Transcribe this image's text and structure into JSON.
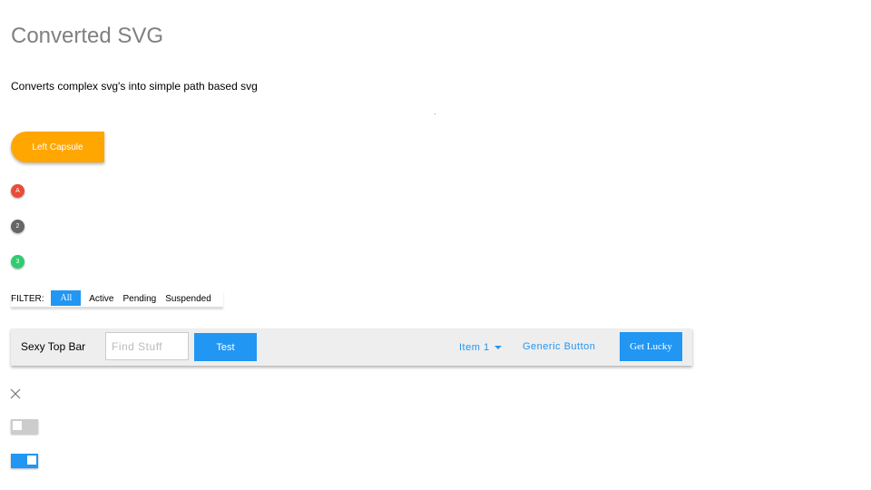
{
  "header": {
    "title": "Converted SVG",
    "subtitle": "Converts complex svg's into simple path based svg"
  },
  "capsule": {
    "label": "Left Capsule",
    "color": "#ffa600"
  },
  "badges": [
    {
      "label": "A",
      "color": "#ea4b3a"
    },
    {
      "label": "2",
      "color": "#666666"
    },
    {
      "label": "3",
      "color": "#2ecc71"
    }
  ],
  "filter": {
    "label": "FILTER:",
    "options": [
      "All",
      "Active",
      "Pending",
      "Suspended"
    ],
    "selected": "All"
  },
  "topbar": {
    "title": "Sexy Top Bar",
    "search_placeholder": "Find Stuff",
    "test_label": "Test",
    "dropdown_label": "Item 1",
    "generic_label": "Generic Button",
    "lucky_label": "Get Lucky",
    "accent": "#2196f3"
  },
  "toggles": [
    {
      "state": "off"
    },
    {
      "state": "on"
    }
  ],
  "icons": {
    "close": "close-icon",
    "dropdown": "caret-down-icon"
  }
}
